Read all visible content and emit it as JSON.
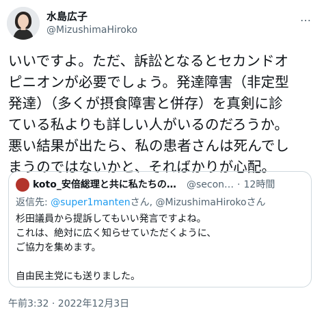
{
  "author": {
    "display_name": "水島広子",
    "handle": "@MizushimaHiroko"
  },
  "more_icon": "…",
  "tweet": {
    "lines": [
      "いいですよ。ただ、訴訟となるとセカンドオ",
      "ピニオンが必要でしょう。発達障害（非定型",
      "発達）（多くが摂食障害と併存）を真剣に診",
      "ている私よりも詳しい人がいるのだろうか。",
      "悪い結果が出たら、私の患者さんは死んでし",
      "まうのではないかと、そればかりが心配。"
    ]
  },
  "quote": {
    "author_name": "koto_安倍総理と共に私たちの美しい日…",
    "author_handle": "@secon…",
    "dot": "·",
    "time": "12時間",
    "reply_prefix": "返信先: ",
    "reply_user1": "@super1manten",
    "reply_san1": "さん, ",
    "reply_user2": "@MizushimaHiroko",
    "reply_san2": "さん",
    "body_lines": [
      "杉田議員から提訴してもいい発言ですよね。",
      "これは、絶対に広く知らせていただくように、",
      "ご協力を集めます。",
      "",
      "自由民主党にも送りました。"
    ]
  },
  "timestamp": "午前3:32 · 2022年12月3日",
  "colors": {
    "secondary_text": "#536471",
    "link": "#1d9bf0",
    "border": "#cfd9de"
  }
}
